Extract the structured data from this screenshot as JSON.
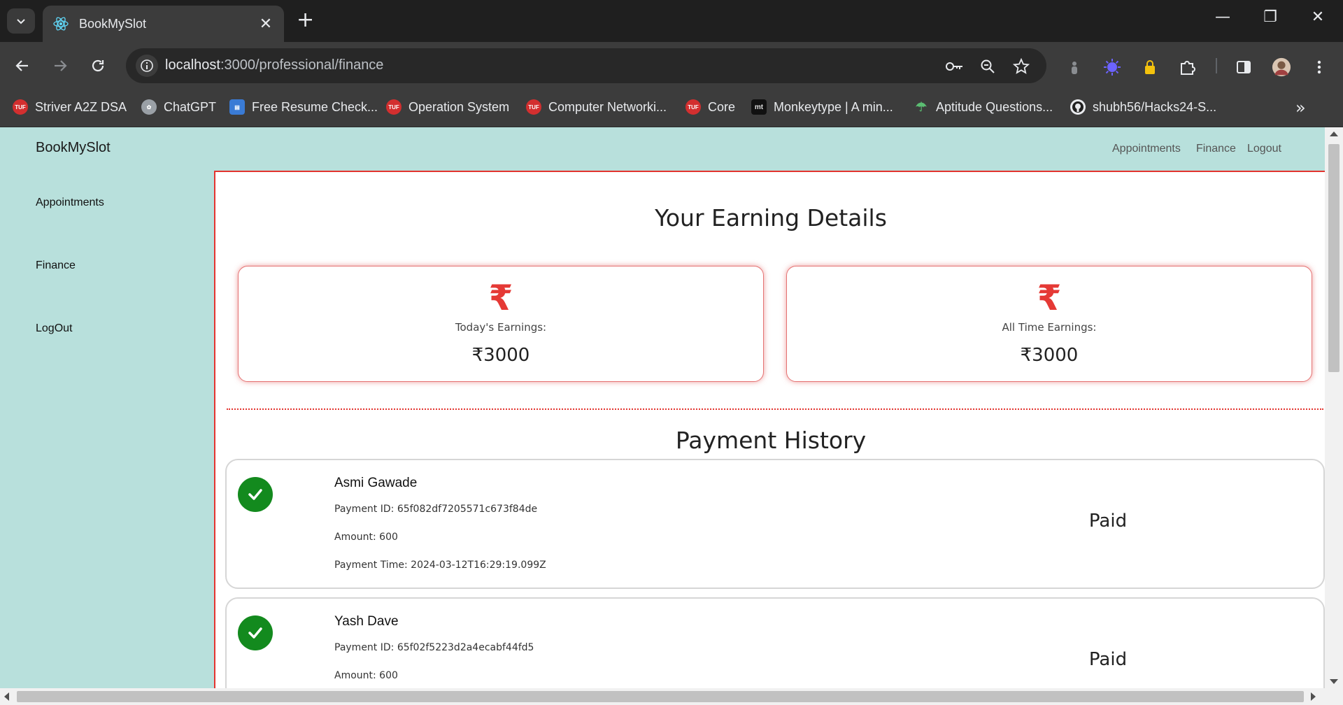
{
  "browser": {
    "tab_title": "BookMySlot",
    "url_host": "localhost",
    "url_rest": ":3000/professional/finance",
    "bookmarks": [
      {
        "label": "Striver A2Z DSA",
        "icon": "tuf-icon"
      },
      {
        "label": "ChatGPT",
        "icon": "chatgpt-icon"
      },
      {
        "label": "Free Resume Check...",
        "icon": "resume-icon"
      },
      {
        "label": "Operation System",
        "icon": "tuf-icon"
      },
      {
        "label": "Computer Networki...",
        "icon": "tuf-icon"
      },
      {
        "label": "Core",
        "icon": "tuf-icon"
      },
      {
        "label": "Monkeytype | A min...",
        "icon": "monkeytype-icon"
      },
      {
        "label": "Aptitude Questions...",
        "icon": "aptitude-icon"
      },
      {
        "label": "shubh56/Hacks24-S...",
        "icon": "github-icon"
      }
    ],
    "tuf_badge": "TUF",
    "mt_badge": "mt"
  },
  "app": {
    "brand": "BookMySlot",
    "top_nav": [
      "Appointments",
      "Finance",
      "Logout"
    ],
    "sidebar": [
      "Appointments",
      "Finance",
      "LogOut"
    ]
  },
  "earnings": {
    "title": "Your Earning Details",
    "currency_symbol": "₹",
    "cards": [
      {
        "label": "Today's Earnings:",
        "amount": "₹3000"
      },
      {
        "label": "All Time Earnings:",
        "amount": "₹3000"
      }
    ]
  },
  "payments": {
    "title": "Payment History",
    "items": [
      {
        "name": "Asmi Gawade",
        "payment_id": "Payment ID: 65f082df7205571c673f84de",
        "amount": "Amount: 600",
        "time": "Payment Time: 2024-03-12T16:29:19.099Z",
        "status": "Paid"
      },
      {
        "name": "Yash Dave",
        "payment_id": "Payment ID: 65f02f5223d2a4ecabf44fd5",
        "amount": "Amount: 600",
        "time": "",
        "status": "Paid"
      }
    ]
  },
  "colors": {
    "accent_red": "#e3342f",
    "teal_bg": "#b8e0dc",
    "success_green": "#138a1e"
  }
}
